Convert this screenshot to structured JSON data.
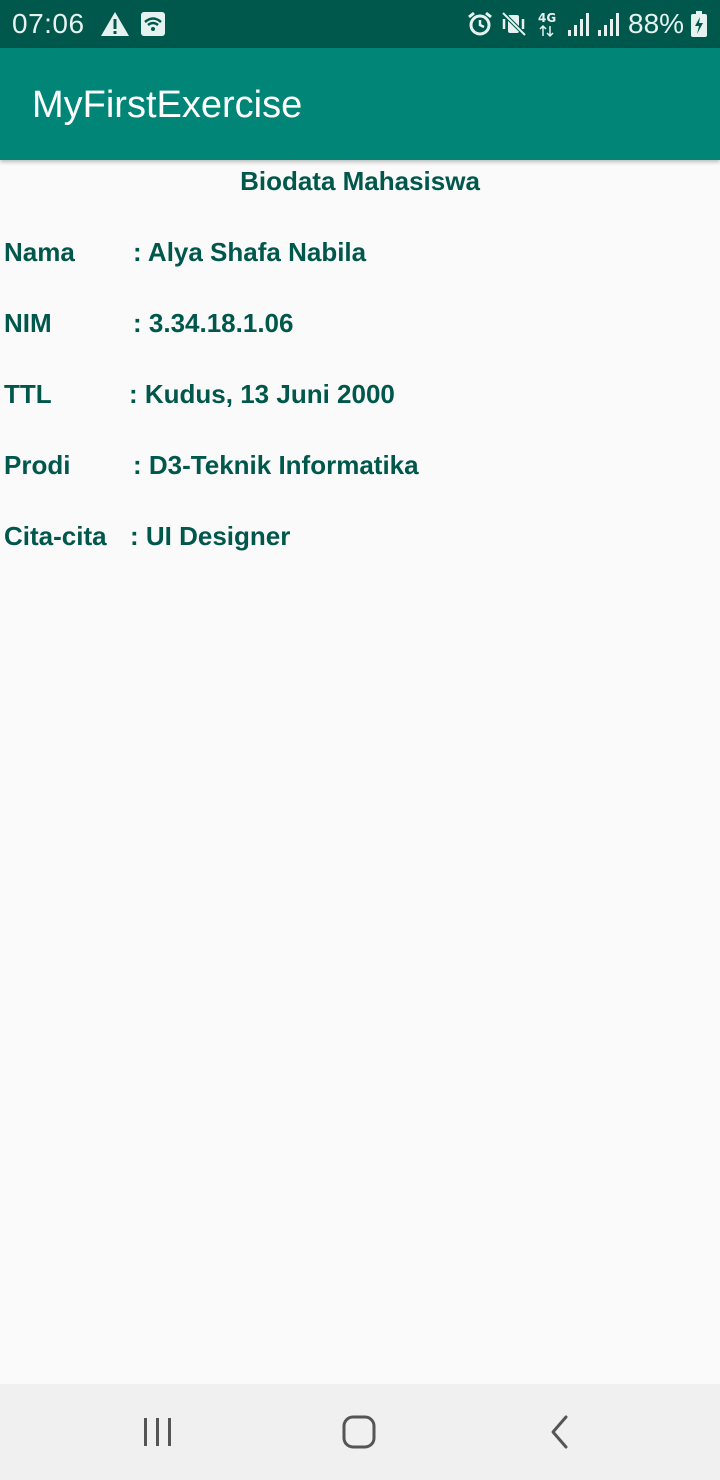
{
  "status_bar": {
    "time": "07:06",
    "battery": "88%",
    "icons": [
      "warning-icon",
      "wifi-icon",
      "alarm-icon",
      "vibrate-icon",
      "network-4g-icon",
      "signal-icon",
      "signal-icon",
      "battery-charging-icon"
    ]
  },
  "app_bar": {
    "title": "MyFirstExercise"
  },
  "main": {
    "heading": "Biodata Mahasiswa",
    "rows": [
      {
        "label": "Nama",
        "value": ": Alya Shafa Nabila"
      },
      {
        "label": "NIM",
        "value": ": 3.34.18.1.06"
      },
      {
        "label": "TTL",
        "value": ": Kudus, 13 Juni 2000"
      },
      {
        "label": "Prodi",
        "value": ": D3-Teknik Informatika"
      },
      {
        "label": "Cita-cita",
        "value": ": UI Designer"
      }
    ]
  },
  "nav_bar": {
    "buttons": [
      "recent-apps-icon",
      "home-icon",
      "back-icon"
    ]
  },
  "colors": {
    "status_bar": "#00574b",
    "app_bar": "#008577",
    "text": "#00574b",
    "background": "#fafafa"
  }
}
